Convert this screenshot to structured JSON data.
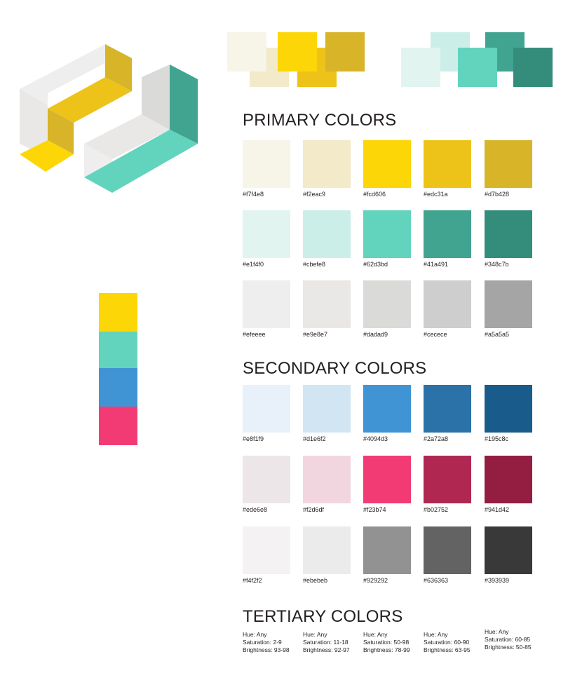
{
  "headings": {
    "primary": "PRIMARY COLORS",
    "secondary": "SECONDARY COLORS",
    "tertiary": "TERTIARY COLORS"
  },
  "logo": {
    "icon": "isometric-interlocking-blocks-logo",
    "colors": {
      "light_gray": "#efeeee",
      "mid_gray": "#e9e8e7",
      "dark_gray": "#dadad9",
      "yellow": "#fcd606",
      "amber": "#edc31a",
      "gold": "#d7b428",
      "teal": "#41a491",
      "turquoise": "#62d3bd"
    }
  },
  "top_swatches": {
    "warm": [
      "#f7f4e8",
      "#f2eac9",
      "#fcd606",
      "#edc31a",
      "#d7b428"
    ],
    "cool": [
      "#e1f4f0",
      "#cbefe8",
      "#62d3bd",
      "#41a491",
      "#348c7b"
    ]
  },
  "color_strip": [
    "#fcd606",
    "#62d3bd",
    "#4094d3",
    "#f23b74"
  ],
  "primary": [
    [
      {
        "color": "#f7f4e8",
        "label": "#f7f4e8"
      },
      {
        "color": "#f2eac9",
        "label": "#f2eac9"
      },
      {
        "color": "#fcd606",
        "label": "#fcd606"
      },
      {
        "color": "#edc31a",
        "label": "#edc31a"
      },
      {
        "color": "#d7b428",
        "label": "#d7b428"
      }
    ],
    [
      {
        "color": "#e1f4f0",
        "label": "#e1f4f0"
      },
      {
        "color": "#cbefe8",
        "label": "#cbefe8"
      },
      {
        "color": "#62d3bd",
        "label": "#62d3bd"
      },
      {
        "color": "#41a491",
        "label": "#41a491"
      },
      {
        "color": "#348c7b",
        "label": "#348c7b"
      }
    ],
    [
      {
        "color": "#efeeee",
        "label": "#efeeee"
      },
      {
        "color": "#e9e8e7",
        "label": "#e9e8e7"
      },
      {
        "color": "#dadad9",
        "label": "#dadad9"
      },
      {
        "color": "#cecece",
        "label": "#cecece"
      },
      {
        "color": "#a5a5a5",
        "label": "#a5a5a5"
      }
    ]
  ],
  "secondary": [
    [
      {
        "color": "#e8f1f9",
        "label": "#e8f1f9"
      },
      {
        "color": "#d1e6f2",
        "label": "#d1e6f2"
      },
      {
        "color": "#4094d3",
        "label": "#4094d3"
      },
      {
        "color": "#2a72a8",
        "label": "#2a72a8"
      },
      {
        "color": "#195c8c",
        "label": "#195c8c"
      }
    ],
    [
      {
        "color": "#ede6e8",
        "label": "#ede6e8"
      },
      {
        "color": "#f2d6df",
        "label": "#f2d6df"
      },
      {
        "color": "#f23b74",
        "label": "#f23b74"
      },
      {
        "color": "#b02752",
        "label": "#b02752"
      },
      {
        "color": "#941d42",
        "label": "#941d42"
      }
    ],
    [
      {
        "color": "#f4f2f2",
        "label": "#f4f2f2"
      },
      {
        "color": "#ebebeb",
        "label": "#ebebeb"
      },
      {
        "color": "#929292",
        "label": "#929292"
      },
      {
        "color": "#636363",
        "label": "#636363"
      },
      {
        "color": "#393939",
        "label": "#393939"
      }
    ]
  ],
  "tertiary": [
    {
      "hue": "Hue: Any",
      "saturation": "Saturation: 2-9",
      "brightness": "Brightness: 93-98"
    },
    {
      "hue": "Hue: Any",
      "saturation": "Saturation: 11-18",
      "brightness": "Brightness: 92-97"
    },
    {
      "hue": "Hue: Any",
      "saturation": "Saturation: 50-98",
      "brightness": "Brightness: 78-99"
    },
    {
      "hue": "Hue: Any",
      "saturation": "Saturation: 60-90",
      "brightness": "Brightness: 63-95"
    },
    {
      "hue": "Hue: Any",
      "saturation": "Saturation: 60-85",
      "brightness": "Brightness: 50-85"
    }
  ]
}
